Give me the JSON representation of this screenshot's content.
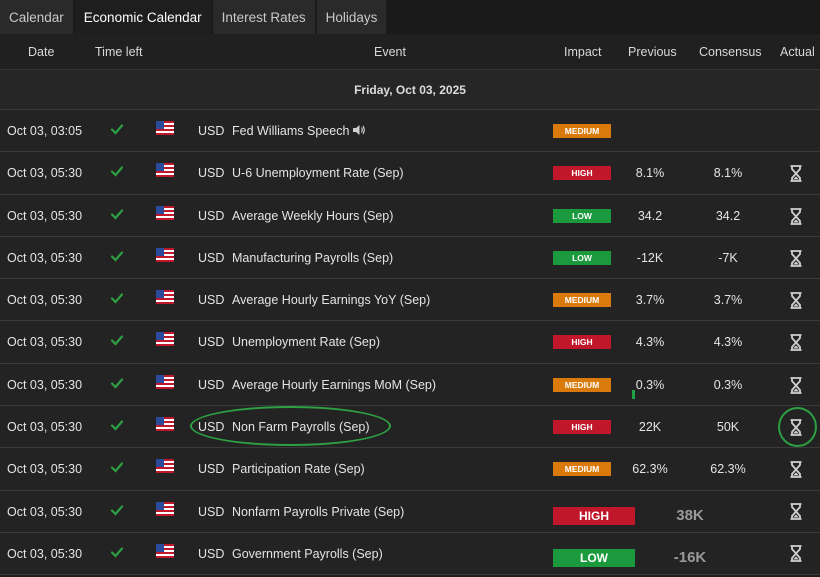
{
  "tabs": [
    {
      "label": "Calendar",
      "active": false
    },
    {
      "label": "Economic Calendar",
      "active": true
    },
    {
      "label": "Interest Rates",
      "active": false
    },
    {
      "label": "Holidays",
      "active": false
    }
  ],
  "columns": {
    "date": "Date",
    "time_left": "Time left",
    "event": "Event",
    "impact": "Impact",
    "previous": "Previous",
    "consensus": "Consensus",
    "actual": "Actual"
  },
  "date_banner": "Friday, Oct 03, 2025",
  "rows": [
    {
      "date": "Oct 03, 03:05",
      "currency": "USD",
      "event": "Fed Williams Speech",
      "impact": "MEDIUM",
      "previous": "",
      "consensus": "",
      "speaker_icon": true,
      "actual_icon": false
    },
    {
      "date": "Oct 03, 05:30",
      "currency": "USD",
      "event": "U-6 Unemployment Rate (Sep)",
      "impact": "HIGH",
      "previous": "8.1%",
      "consensus": "8.1%",
      "actual_icon": true
    },
    {
      "date": "Oct 03, 05:30",
      "currency": "USD",
      "event": "Average Weekly Hours (Sep)",
      "impact": "LOW",
      "previous": "34.2",
      "consensus": "34.2",
      "actual_icon": true
    },
    {
      "date": "Oct 03, 05:30",
      "currency": "USD",
      "event": "Manufacturing Payrolls (Sep)",
      "impact": "LOW",
      "previous": "-12K",
      "consensus": "-7K",
      "actual_icon": true
    },
    {
      "date": "Oct 03, 05:30",
      "currency": "USD",
      "event": "Average Hourly Earnings YoY (Sep)",
      "impact": "MEDIUM",
      "previous": "3.7%",
      "consensus": "3.7%",
      "actual_icon": true
    },
    {
      "date": "Oct 03, 05:30",
      "currency": "USD",
      "event": "Unemployment Rate (Sep)",
      "impact": "HIGH",
      "previous": "4.3%",
      "consensus": "4.3%",
      "actual_icon": true
    },
    {
      "date": "Oct 03, 05:30",
      "currency": "USD",
      "event": "Average Hourly Earnings MoM (Sep)",
      "impact": "MEDIUM",
      "previous": "0.3%",
      "consensus": "0.3%",
      "actual_icon": true
    },
    {
      "date": "Oct 03, 05:30",
      "currency": "USD",
      "event": "Non Farm Payrolls (Sep)",
      "impact": "HIGH",
      "previous": "22K",
      "consensus": "50K",
      "actual_icon": true
    },
    {
      "date": "Oct 03, 05:30",
      "currency": "USD",
      "event": "Participation Rate (Sep)",
      "impact": "MEDIUM",
      "previous": "62.3%",
      "consensus": "62.3%",
      "actual_icon": true
    },
    {
      "date": "Oct 03, 05:30",
      "currency": "USD",
      "event": "Nonfarm Payrolls Private (Sep)",
      "impact": "HIGH",
      "previous": "38K",
      "consensus": "",
      "actual_icon": true,
      "distorted": true
    },
    {
      "date": "Oct 03, 05:30",
      "currency": "USD",
      "event": "Government Payrolls (Sep)",
      "impact": "LOW",
      "previous": "-16K",
      "consensus": "",
      "actual_icon": true,
      "distorted": true
    }
  ],
  "colors": {
    "high": "#c0182a",
    "medium": "#d97a0a",
    "low": "#1a9a3c",
    "check": "#2ea043",
    "highlight_circle": "#2ea043"
  }
}
